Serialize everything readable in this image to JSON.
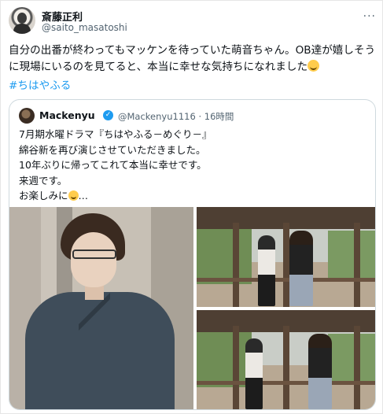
{
  "tweet": {
    "author_name": "斎藤正利",
    "author_handle": "@saito_masatoshi",
    "more_icon": "more-horizontal-icon",
    "text": "自分の出番が終わってもマッケンを待っていた萌音ちゃん。OB達が嬉しそうに現場にいるのを見てると、本当に幸せな気持ちになれました",
    "text_emoji": "smiling-face-icon",
    "hashtag": "#ちはやふる"
  },
  "quoted_tweet": {
    "author_name": "Mackenyu",
    "verified_icon": "verified-badge-icon",
    "author_handle": "@Mackenyu1116",
    "time": "· 16時間",
    "lines": [
      "7月期水曜ドラマ『ちはやふる－めぐり－』",
      "綿谷新を再び演じさせていただきました。",
      "10年ぶりに帰ってこれて本当に幸せです。",
      "来週です。",
      "お楽しみに"
    ],
    "last_line_suffix": "…",
    "media": {
      "count": 3,
      "main_photo": "actor-in-kimono-photo",
      "top_right_photo": "two-people-on-wooden-corridor-photo",
      "bottom_right_photo": "two-people-on-wooden-corridor-photo-2"
    }
  },
  "colors": {
    "accent": "#1d9bf0",
    "text": "#0f1419",
    "secondary": "#536471",
    "border": "#cfd9de"
  }
}
